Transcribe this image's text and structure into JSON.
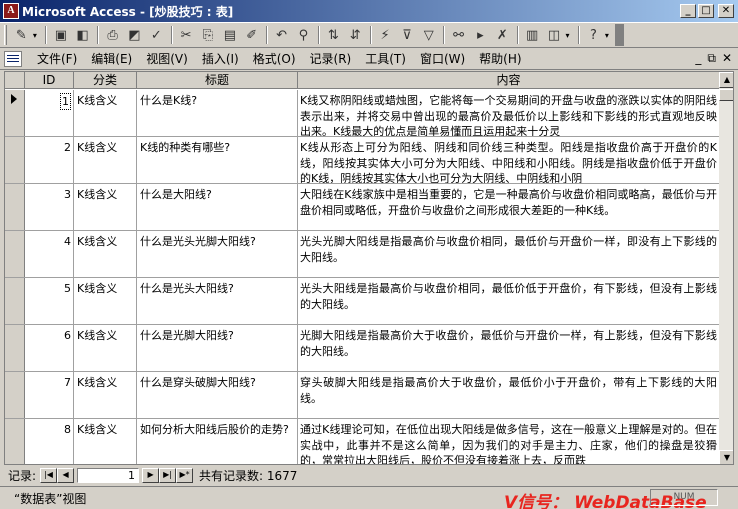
{
  "window": {
    "title": "Microsoft Access - [炒股技巧 : 表]",
    "app_icon_letter": "A"
  },
  "menu": [
    "文件(F)",
    "编辑(E)",
    "视图(V)",
    "插入(I)",
    "格式(O)",
    "记录(R)",
    "工具(T)",
    "窗口(W)",
    "帮助(H)"
  ],
  "menu_right": [
    "_",
    "⧉",
    "✕"
  ],
  "columns": [
    "ID",
    "分类",
    "标题",
    "内容"
  ],
  "rows": [
    {
      "id": "1",
      "cat": "K线含义",
      "title": "什么是K线?",
      "content": "K线又称阴阳线或蜡烛图，它能将每一个交易期间的开盘与收盘的涨跌以实体的阴阳线表示出来，并将交易中曾出现的最高价及最低价以上影线和下影线的形式直观地反映出来。K线最大的优点是简单易懂而且运用起来十分灵"
    },
    {
      "id": "2",
      "cat": "K线含义",
      "title": "K线的种类有哪些?",
      "content": "K线从形态上可分为阳线、阴线和同价线三种类型。阳线是指收盘价高于开盘价的K线，阳线按其实体大小可分为大阳线、中阳线和小阳线。阴线是指收盘价低于开盘价的K线，阴线按其实体大小也可分为大阴线、中阴线和小阴"
    },
    {
      "id": "3",
      "cat": "K线含义",
      "title": "什么是大阳线?",
      "content": "大阳线在K线家族中是相当重要的，它是一种最高价与收盘价相同或略高，最低价与开盘价相同或略低，开盘价与收盘价之间形成很大差距的一种K线。"
    },
    {
      "id": "4",
      "cat": "K线含义",
      "title": "什么是光头光脚大阳线?",
      "content": "光头光脚大阳线是指最高价与收盘价相同，最低价与开盘价一样，即没有上下影线的大阳线。"
    },
    {
      "id": "5",
      "cat": "K线含义",
      "title": "什么是光头大阳线?",
      "content": "光头大阳线是指最高价与收盘价相同，最低价低于开盘价，有下影线，但没有上影线的大阳线。"
    },
    {
      "id": "6",
      "cat": "K线含义",
      "title": "什么是光脚大阳线?",
      "content": "光脚大阳线是指最高价大于收盘价，最低价与开盘价一样，有上影线，但没有下影线的大阳线。"
    },
    {
      "id": "7",
      "cat": "K线含义",
      "title": "什么是穿头破脚大阳线?",
      "content": "穿头破脚大阳线是指最高价大于收盘价，最低价小于开盘价，带有上下影线的大阳线。"
    },
    {
      "id": "8",
      "cat": "K线含义",
      "title": "如何分析大阳线后股价的走势?",
      "content": "通过K线理论可知，在低位出现大阳线是做多信号，这在一般意义上理解是对的。但在实战中，此事并不是这么简单，因为我们的对手是主力、庄家，他们的操盘是狡猾的，常常拉出大阳线后，股价不但没有接着涨上去，反而跌"
    }
  ],
  "navigator": {
    "label": "记录:",
    "current": "1",
    "total": "共有记录数: 1677"
  },
  "status": {
    "view": "“数据表”视图",
    "watermark": "V信号： WebDataBase",
    "indicator": "NUM"
  }
}
